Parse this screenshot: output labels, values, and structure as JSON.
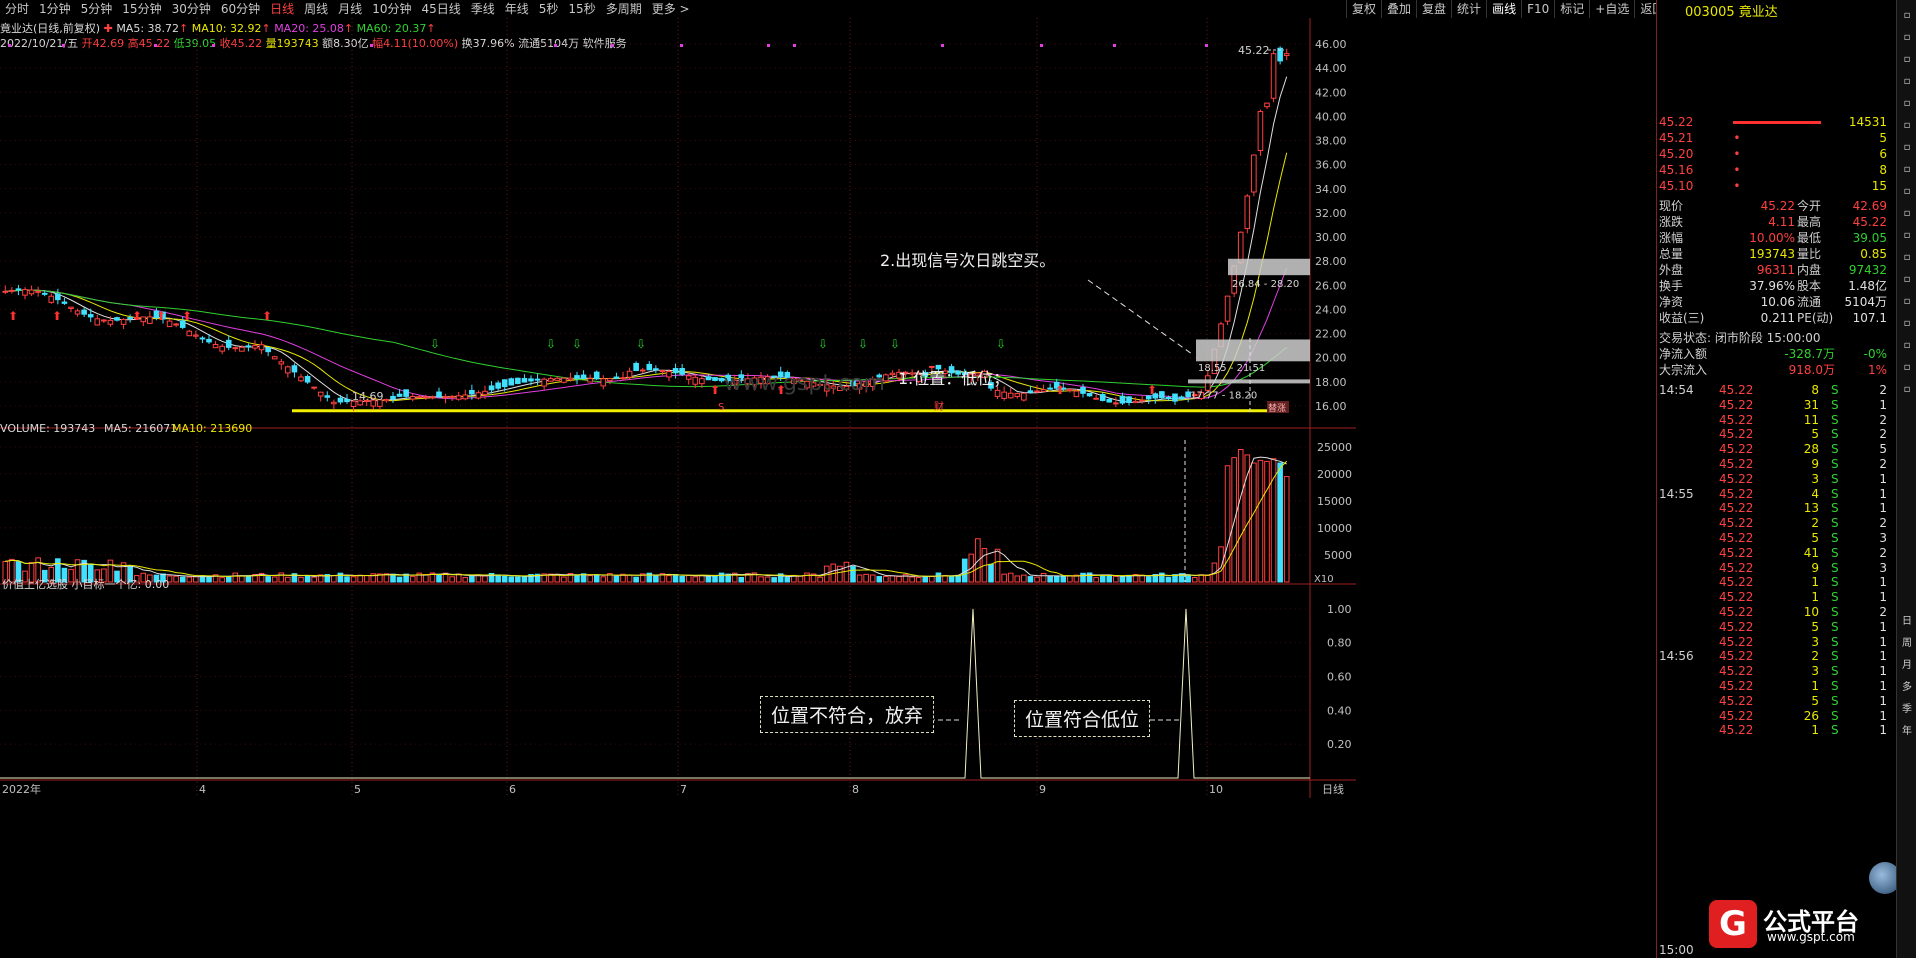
{
  "toolbar": {
    "periods": [
      "分时",
      "1分钟",
      "5分钟",
      "15分钟",
      "30分钟",
      "60分钟",
      "日线",
      "周线",
      "月线",
      "10分钟",
      "45日线",
      "季线",
      "年线",
      "5秒",
      "15秒",
      "多周期",
      "更多 >"
    ],
    "active_index": 6,
    "right_buttons": [
      "复权",
      "叠加",
      "复盘",
      "统计",
      "画线",
      "F10",
      "标记",
      "+自选",
      "返回"
    ]
  },
  "info": {
    "stock_label": "竟业达(日线,前复权)",
    "ma5": "MA5: 38.72",
    "ma10": "MA10: 32.92",
    "ma20": "MA20: 25.08",
    "ma60": "MA60: 20.37",
    "line2_date": "2022/10/21/五",
    "open": "开42.69",
    "high": "高45.22",
    "low": "低39.05",
    "close": "收45.22",
    "vol": "量193743",
    "amount": "额8.30亿",
    "change": "幅4.11(10.00%)",
    "turnover": "换37.96%",
    "float": "流通5104万",
    "service": "软件服务"
  },
  "chart_data": [
    {
      "type": "candlestick",
      "title": "竟业达(日线,前复权)",
      "y_ticks": [
        "46.00",
        "44.00",
        "42.00",
        "40.00",
        "38.00",
        "36.00",
        "34.00",
        "32.00",
        "30.00",
        "28.00",
        "26.00",
        "24.00",
        "22.00",
        "20.00",
        "18.00",
        "16.00"
      ],
      "ylim": [
        15.0,
        46.5
      ],
      "x_ticks": [
        "2022年",
        "4",
        "5",
        "6",
        "7",
        "8",
        "9",
        "10"
      ],
      "price_labels": [
        "45.22",
        "14.69",
        "26.84 - 28.20",
        "18.55 - 21.51",
        "17.77 - 18.20"
      ],
      "support_line": 15.6,
      "markers": [
        "S",
        "财",
        "替涨"
      ],
      "annotations": [
        "2.出现信号次日跳空买。",
        "1.位置：低位；"
      ],
      "watermark": "www.gspt.com"
    },
    {
      "type": "bar",
      "title": "VOLUME: 193743",
      "legend": [
        "VOLUME: 193743",
        "MA5: 216071",
        "MA10: 213690"
      ],
      "y_ticks": [
        "25000",
        "20000",
        "15000",
        "10000",
        "5000"
      ],
      "unit": "X10",
      "ylim": [
        0,
        27000
      ]
    },
    {
      "type": "line",
      "title": "价值上亿选股 小目标一个亿: 0.00",
      "y_ticks": [
        "1.00",
        "0.80",
        "0.60",
        "0.40",
        "0.20"
      ],
      "ylim": [
        0,
        1.1
      ],
      "annotations": [
        "位置不符合，放弃",
        "位置符合低位"
      ],
      "bottom_right": "日线"
    }
  ],
  "panel": {
    "code": "003005",
    "name": "竟业达",
    "sell_orders": [
      {
        "price": "45.22",
        "vol": "14531"
      },
      {
        "price": "45.21",
        "vol": "5"
      },
      {
        "price": "45.20",
        "vol": "6"
      },
      {
        "price": "45.16",
        "vol": "8"
      },
      {
        "price": "45.10",
        "vol": "15"
      }
    ],
    "quote": [
      {
        "l": "现价",
        "v": "45.22",
        "l2": "今开",
        "v2": "42.69"
      },
      {
        "l": "涨跌",
        "v": "4.11",
        "l2": "最高",
        "v2": "45.22"
      },
      {
        "l": "涨幅",
        "v": "10.00%",
        "l2": "最低",
        "v2": "39.05"
      },
      {
        "l": "总量",
        "v": "193743",
        "l2": "量比",
        "v2": "0.85"
      },
      {
        "l": "外盘",
        "v": "96311",
        "l2": "内盘",
        "v2": "97432"
      },
      {
        "l": "换手",
        "v": "37.96%",
        "l2": "股本",
        "v2": "1.48亿"
      },
      {
        "l": "净资",
        "v": "10.06",
        "l2": "流通",
        "v2": "5104万"
      },
      {
        "l": "收益(三)",
        "v": "0.211",
        "l2": "PE(动)",
        "v2": "107.1"
      }
    ],
    "status": "交易状态: 闭市阶段 15:00:00",
    "flow1_label": "净流入额",
    "flow1_val": "-328.7万",
    "flow1_pct": "-0%",
    "flow2_label": "大宗流入",
    "flow2_val": "918.0万",
    "flow2_pct": "1%",
    "ticks": [
      {
        "t": "14:54",
        "p": "45.22",
        "v": "8",
        "s": "S",
        "n": "2"
      },
      {
        "t": "",
        "p": "45.22",
        "v": "31",
        "s": "S",
        "n": "1"
      },
      {
        "t": "",
        "p": "45.22",
        "v": "11",
        "s": "S",
        "n": "2"
      },
      {
        "t": "",
        "p": "45.22",
        "v": "5",
        "s": "S",
        "n": "2"
      },
      {
        "t": "",
        "p": "45.22",
        "v": "28",
        "s": "S",
        "n": "5"
      },
      {
        "t": "",
        "p": "45.22",
        "v": "9",
        "s": "S",
        "n": "2"
      },
      {
        "t": "",
        "p": "45.22",
        "v": "3",
        "s": "S",
        "n": "1"
      },
      {
        "t": "14:55",
        "p": "45.22",
        "v": "4",
        "s": "S",
        "n": "1"
      },
      {
        "t": "",
        "p": "45.22",
        "v": "13",
        "s": "S",
        "n": "1"
      },
      {
        "t": "",
        "p": "45.22",
        "v": "2",
        "s": "S",
        "n": "2"
      },
      {
        "t": "",
        "p": "45.22",
        "v": "5",
        "s": "S",
        "n": "3"
      },
      {
        "t": "",
        "p": "45.22",
        "v": "41",
        "s": "S",
        "n": "2"
      },
      {
        "t": "",
        "p": "45.22",
        "v": "9",
        "s": "S",
        "n": "3"
      },
      {
        "t": "",
        "p": "45.22",
        "v": "1",
        "s": "S",
        "n": "1"
      },
      {
        "t": "",
        "p": "45.22",
        "v": "1",
        "s": "S",
        "n": "1"
      },
      {
        "t": "",
        "p": "45.22",
        "v": "10",
        "s": "S",
        "n": "2"
      },
      {
        "t": "",
        "p": "45.22",
        "v": "5",
        "s": "S",
        "n": "1"
      },
      {
        "t": "",
        "p": "45.22",
        "v": "3",
        "s": "S",
        "n": "1"
      },
      {
        "t": "14:56",
        "p": "45.22",
        "v": "2",
        "s": "S",
        "n": "1"
      },
      {
        "t": "",
        "p": "45.22",
        "v": "3",
        "s": "S",
        "n": "1"
      },
      {
        "t": "",
        "p": "45.22",
        "v": "1",
        "s": "S",
        "n": "1"
      },
      {
        "t": "",
        "p": "45.22",
        "v": "5",
        "s": "S",
        "n": "1"
      },
      {
        "t": "",
        "p": "45.22",
        "v": "26",
        "s": "S",
        "n": "1"
      },
      {
        "t": "",
        "p": "45.22",
        "v": "1",
        "s": "S",
        "n": "1"
      }
    ],
    "bottom_time": "15:00",
    "logo": "公式平台",
    "logo_url": "www.gspt.com"
  },
  "sidebar": [
    "日",
    "周",
    "月",
    "多",
    "季",
    "年"
  ],
  "colors": {
    "up": "#ff4040",
    "down": "#40e0ff",
    "ma5": "#e0e0e0",
    "ma10": "#e8e800",
    "ma20": "#e040e0",
    "ma60": "#30d030"
  }
}
